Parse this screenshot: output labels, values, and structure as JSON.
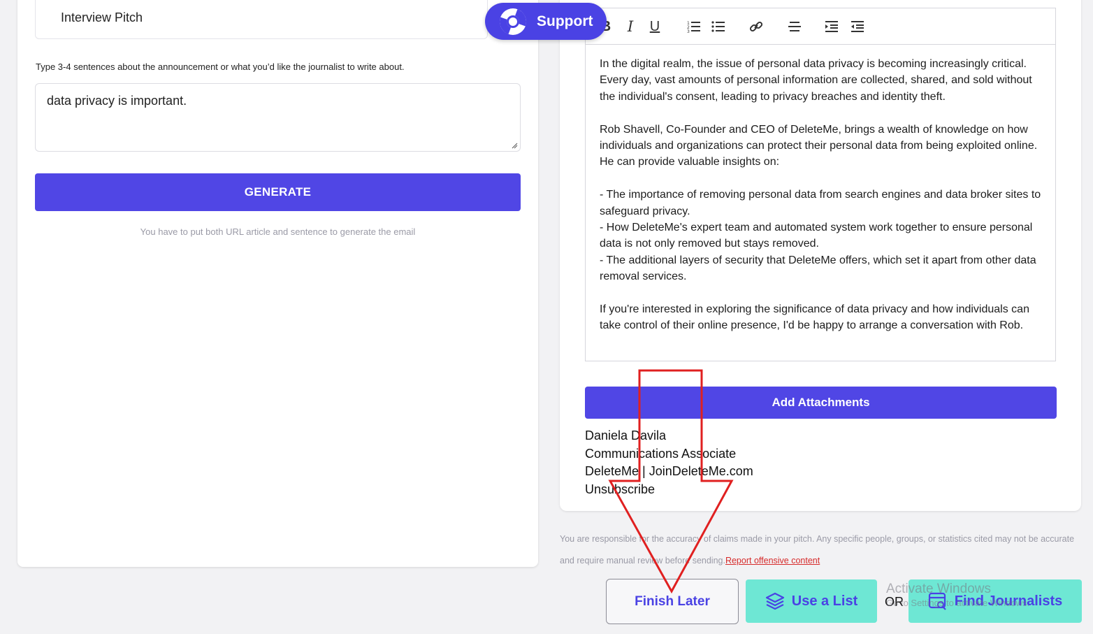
{
  "left_panel": {
    "pitch_type_value": "Interview Pitch",
    "instruction": "Type 3-4 sentences about the announcement or what you’d like the journalist to write about.",
    "sentence_value": "data privacy is important.",
    "generate_label": "GENERATE",
    "hint": "You have to put both URL article and sentence to generate the email"
  },
  "support": {
    "label": "Support",
    "icon": "lifebuoy-icon"
  },
  "editor": {
    "toolbar": [
      "bold-icon",
      "italic-icon",
      "underline-icon",
      "ordered-list-icon",
      "bullet-list-icon",
      "link-icon",
      "strikethrough-icon",
      "indent-icon",
      "outdent-icon"
    ],
    "paragraphs": [
      "In the digital realm, the issue of personal data privacy is becoming increasingly critical. Every day, vast amounts of personal information are collected, shared, and sold without the individual's consent, leading to privacy breaches and identity theft.",
      "Rob Shavell, Co-Founder and CEO of DeleteMe, brings a wealth of knowledge on how individuals and organizations can protect their personal data from being exploited online. He can provide valuable insights on:",
      "- The importance of removing personal data from search engines and data broker sites to safeguard privacy.",
      "- How DeleteMe's expert team and automated system work together to ensure personal data is not only removed but stays removed.",
      "- The additional layers of security that DeleteMe offers, which set it apart from other data removal services.",
      "If you're interested in exploring the significance of data privacy and how individuals can take control of their online presence, I'd be happy to arrange a conversation with Rob."
    ]
  },
  "add_attachments_label": "Add Attachments",
  "signature": {
    "name": "Daniela Davila",
    "title": "Communications Associate",
    "company": "DeleteMe | JoinDeleteMe.com",
    "unsubscribe": "Unsubscribe"
  },
  "disclaimer": {
    "text": "You are responsible for the accuracy of claims made in your pitch. Any specific people, groups, or statistics cited may not be accurate and require manual review before sending.",
    "link": "Report offensive content"
  },
  "actions": {
    "finish_later": "Finish Later",
    "use_list": "Use a List",
    "or": "OR",
    "find_journalists": "Find Journalists"
  },
  "watermark": {
    "line1": "Activate Windows",
    "line2": "Go to Settings to activate Windows."
  },
  "colors": {
    "primary": "#5046e5",
    "teal": "#6ee7d4",
    "annotation": "#e02020"
  }
}
